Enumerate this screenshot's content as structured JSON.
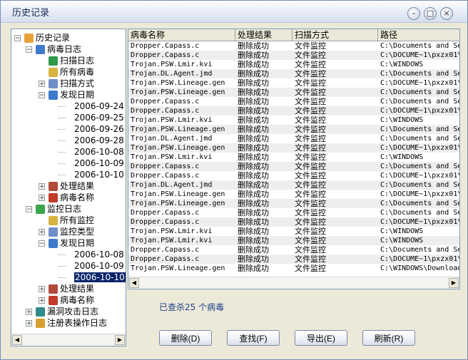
{
  "window": {
    "title": "历史记录"
  },
  "tree": [
    {
      "label": "历史记录",
      "level": 0,
      "exp": "-",
      "color": "#e8a23a"
    },
    {
      "label": "病毒日志",
      "level": 1,
      "exp": "-",
      "color": "#3d7acb"
    },
    {
      "label": "扫描日志",
      "level": 2,
      "exp": "",
      "color": "#2e9a4a"
    },
    {
      "label": "所有病毒",
      "level": 2,
      "exp": "",
      "color": "#d8b440"
    },
    {
      "label": "扫描方式",
      "level": 2,
      "exp": "+",
      "color": "#6f8fc8"
    },
    {
      "label": "发现日期",
      "level": 2,
      "exp": "-",
      "color": "#3d7acb"
    },
    {
      "label": "2006-09-24",
      "level": 3,
      "exp": ""
    },
    {
      "label": "2006-09-25",
      "level": 3,
      "exp": ""
    },
    {
      "label": "2006-09-26",
      "level": 3,
      "exp": ""
    },
    {
      "label": "2006-09-28",
      "level": 3,
      "exp": ""
    },
    {
      "label": "2006-10-08",
      "level": 3,
      "exp": ""
    },
    {
      "label": "2006-10-09",
      "level": 3,
      "exp": ""
    },
    {
      "label": "2006-10-10",
      "level": 3,
      "exp": ""
    },
    {
      "label": "处理结果",
      "level": 2,
      "exp": "+",
      "color": "#b04a3a"
    },
    {
      "label": "病毒名称",
      "level": 2,
      "exp": "+",
      "color": "#c23a2a"
    },
    {
      "label": "监控日志",
      "level": 1,
      "exp": "-",
      "color": "#3aa44a"
    },
    {
      "label": "所有监控",
      "level": 2,
      "exp": "",
      "color": "#d8b440"
    },
    {
      "label": "监控类型",
      "level": 2,
      "exp": "+",
      "color": "#6f8fc8"
    },
    {
      "label": "发现日期",
      "level": 2,
      "exp": "-",
      "color": "#3d7acb"
    },
    {
      "label": "2006-10-08",
      "level": 3,
      "exp": ""
    },
    {
      "label": "2006-10-09",
      "level": 3,
      "exp": ""
    },
    {
      "label": "2006-10-10",
      "level": 3,
      "exp": "",
      "selected": true
    },
    {
      "label": "处理结果",
      "level": 2,
      "exp": "+",
      "color": "#b04a3a"
    },
    {
      "label": "病毒名称",
      "level": 2,
      "exp": "+",
      "color": "#c23a2a"
    },
    {
      "label": "漏洞攻击日志",
      "level": 1,
      "exp": "+",
      "color": "#2f8a8a"
    },
    {
      "label": "注册表操作日志",
      "level": 1,
      "exp": "+",
      "color": "#d8a030"
    }
  ],
  "table": {
    "columns": [
      "病毒名称",
      "处理结果",
      "扫描方式",
      "路径"
    ],
    "rows": [
      [
        "Dropper.Capass.c",
        "删除成功",
        "文件监控",
        "C:\\Documents and Se"
      ],
      [
        "Dropper.Capass.c",
        "删除成功",
        "文件监控",
        "C:\\DOCUME~1\\pxzx01\\"
      ],
      [
        "Trojan.PSW.Lmir.kvi",
        "删除成功",
        "文件监控",
        "C:\\WINDOWS"
      ],
      [
        "Trojan.DL.Agent.jmd",
        "删除成功",
        "文件监控",
        "C:\\Documents and Se"
      ],
      [
        "Trojan.PSW.Lineage.gen",
        "删除成功",
        "文件监控",
        "C:\\DOCUME~1\\pxzx01\\"
      ],
      [
        "Trojan.PSW.Lineage.gen",
        "删除成功",
        "文件监控",
        "C:\\Documents and Se"
      ],
      [
        "Dropper.Capass.c",
        "删除成功",
        "文件监控",
        "C:\\Documents and Se"
      ],
      [
        "Dropper.Capass.c",
        "删除成功",
        "文件监控",
        "C:\\DOCUME~1\\pxzx01\\"
      ],
      [
        "Trojan.PSW.Lmir.kvi",
        "删除成功",
        "文件监控",
        "C:\\WINDOWS"
      ],
      [
        "Trojan.PSW.Lineage.gen",
        "删除成功",
        "文件监控",
        "C:\\Documents and Se"
      ],
      [
        "Trojan.DL.Agent.jmd",
        "删除成功",
        "文件监控",
        "C:\\Documents and Se"
      ],
      [
        "Trojan.PSW.Lineage.gen",
        "删除成功",
        "文件监控",
        "C:\\DOCUME~1\\pxzx01\\"
      ],
      [
        "Trojan.PSW.Lmir.kvi",
        "删除成功",
        "文件监控",
        "C:\\WINDOWS"
      ],
      [
        "Dropper.Capass.c",
        "删除成功",
        "文件监控",
        "C:\\Documents and Se"
      ],
      [
        "Dropper.Capass.c",
        "删除成功",
        "文件监控",
        "C:\\DOCUME~1\\pxzx01\\"
      ],
      [
        "Trojan.DL.Agent.jmd",
        "删除成功",
        "文件监控",
        "C:\\Documents and Se"
      ],
      [
        "Trojan.PSW.Lineage.gen",
        "删除成功",
        "文件监控",
        "C:\\DOCUME~1\\pxzx01\\"
      ],
      [
        "Trojan.PSW.Lineage.gen",
        "删除成功",
        "文件监控",
        "C:\\Documents and Se"
      ],
      [
        "Dropper.Capass.c",
        "删除成功",
        "文件监控",
        "C:\\Documents and Se"
      ],
      [
        "Dropper.Capass.c",
        "删除成功",
        "文件监控",
        "C:\\DOCUME~1\\pxzx01\\"
      ],
      [
        "Trojan.PSW.Lmir.kvi",
        "删除成功",
        "文件监控",
        "C:\\WINDOWS"
      ],
      [
        "Trojan.PSW.Lmir.kvi",
        "删除成功",
        "文件监控",
        "C:\\WINDOWS"
      ],
      [
        "Dropper.Capass.c",
        "删除成功",
        "文件监控",
        "C:\\Documents and Se"
      ],
      [
        "Dropper.Capass.c",
        "删除成功",
        "文件监控",
        "C:\\DOCUME~1\\pxzx01\\"
      ],
      [
        "Trojan.PSW.Lineage.gen",
        "删除成功",
        "文件监控",
        "C:\\WINDOWS\\Download"
      ]
    ]
  },
  "status": {
    "text": "已查杀25 个病毒"
  },
  "buttons": {
    "delete": "删除(D)",
    "find": "查找(F)",
    "export": "导出(E)",
    "refresh": "刷新(R)"
  },
  "icons": {
    "minimize": "minimize-icon",
    "restore": "restore-icon",
    "close": "close-icon"
  }
}
